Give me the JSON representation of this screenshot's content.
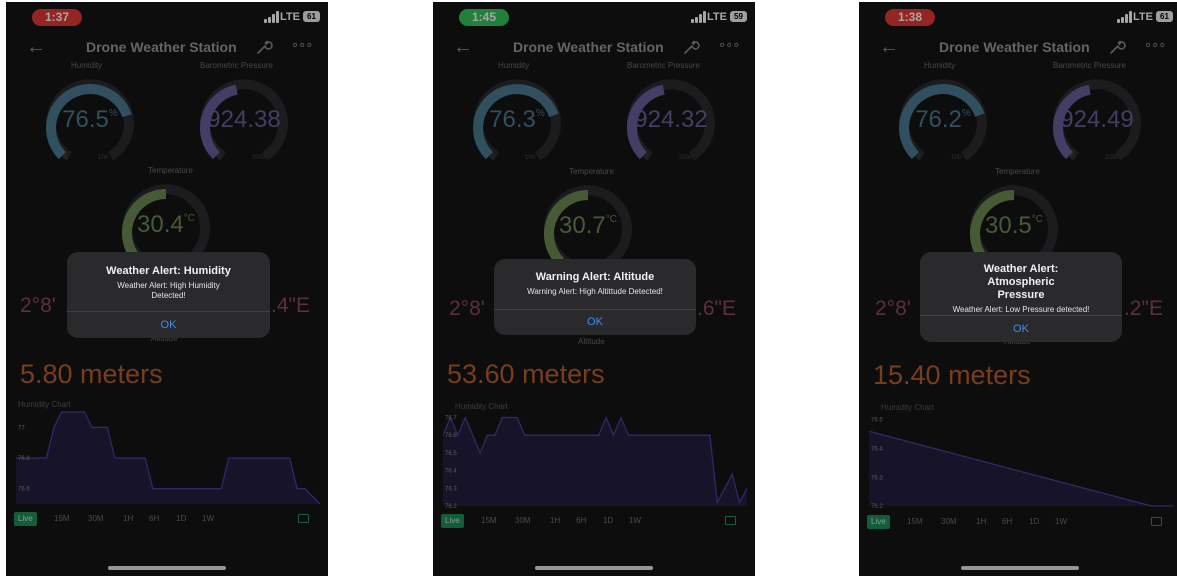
{
  "screens": [
    {
      "status": {
        "time": "1:37",
        "pill_color": "#e53935",
        "lte": "LTE",
        "battery": "61"
      },
      "nav": {
        "title": "Drone Weather Station"
      },
      "humidity": {
        "label": "Humidity",
        "value": "76.5",
        "unit": "%",
        "min": "0",
        "max": "100",
        "fraction": 0.765
      },
      "pressure": {
        "label": "Barometric Pressure",
        "value": "924.38",
        "min": "0",
        "max": "2000",
        "fraction": 0.46
      },
      "temperature": {
        "label": "Temperature",
        "value": "30.4",
        "unit": "°C",
        "fraction": 0.5
      },
      "coords": {
        "left": "2°8'",
        "right": ".4\"E"
      },
      "altitude": {
        "label": "Altitude",
        "value": "5.80 meters"
      },
      "chart_title": "Humidity Chart",
      "ranges": [
        "Live",
        "15M",
        "30M",
        "1H",
        "6H",
        "1D",
        "1W"
      ],
      "alert": {
        "title": "Weather Alert: Humidity",
        "message": "Weather Alert: High Humidity Detected!",
        "ok": "OK"
      }
    },
    {
      "status": {
        "time": "1:45",
        "pill_color": "#34c759",
        "lte": "LTE",
        "battery": "59"
      },
      "nav": {
        "title": "Drone Weather Station"
      },
      "humidity": {
        "label": "Humidity",
        "value": "76.3",
        "unit": "%",
        "min": "0",
        "max": "100",
        "fraction": 0.763
      },
      "pressure": {
        "label": "Barometric Pressure",
        "value": "924.32",
        "min": "0",
        "max": "2000",
        "fraction": 0.46
      },
      "temperature": {
        "label": "Temperature",
        "value": "30.7",
        "unit": "°C",
        "fraction": 0.5
      },
      "coords": {
        "left": "2°8'",
        "right": ".6\"E"
      },
      "altitude": {
        "label": "Altitude",
        "value": "53.60 meters"
      },
      "chart_title": "Humidity Chart",
      "ranges": [
        "Live",
        "15M",
        "30M",
        "1H",
        "6H",
        "1D",
        "1W"
      ],
      "alert": {
        "title": "Warning Alert: Altitude",
        "message": "Warning Alert: High Altittude Detected!",
        "ok": "OK"
      }
    },
    {
      "status": {
        "time": "1:38",
        "pill_color": "#e53935",
        "lte": "LTE",
        "battery": "61"
      },
      "nav": {
        "title": "Drone Weather Station"
      },
      "humidity": {
        "label": "Humidity",
        "value": "76.2",
        "unit": "%",
        "min": "0",
        "max": "100",
        "fraction": 0.762
      },
      "pressure": {
        "label": "Barometric Pressure",
        "value": "924.49",
        "min": "0",
        "max": "2000",
        "fraction": 0.46
      },
      "temperature": {
        "label": "Temperature",
        "value": "30.5",
        "unit": "°C",
        "fraction": 0.5
      },
      "coords": {
        "left": "2°8'",
        "right": ".2\"E"
      },
      "altitude": {
        "label": "Altitude",
        "value": "15.40 meters"
      },
      "chart_title": "Humidity Chart",
      "ranges": [
        "Live",
        "15M",
        "30M",
        "1H",
        "6H",
        "1D",
        "1W"
      ],
      "alert": {
        "title": "Weather Alert: Atmospheric Pressure",
        "message": "Weather Alert: Low Pressure detected!",
        "ok": "OK"
      }
    }
  ],
  "chart_data": [
    {
      "type": "area",
      "ticks": [
        "77",
        "76.8",
        "76.6"
      ],
      "ylim": [
        76.5,
        77.1
      ],
      "y": [
        76.8,
        76.8,
        76.8,
        76.8,
        76.8,
        77,
        77.1,
        77.1,
        77.1,
        77.1,
        77,
        77,
        77,
        76.8,
        76.8,
        76.8,
        76.8,
        76.8,
        76.6,
        76.6,
        76.6,
        76.6,
        76.6,
        76.6,
        76.6,
        76.6,
        76.6,
        76.6,
        76.8,
        76.8,
        76.8,
        76.8,
        76.8,
        76.8,
        76.8,
        76.8,
        76.8,
        76.6,
        76.6,
        76.55,
        76.5
      ]
    },
    {
      "type": "area",
      "ticks": [
        "76.7",
        "76.6",
        "76.5",
        "76.4",
        "76.3",
        "76.2"
      ],
      "ylim": [
        76.2,
        76.72
      ],
      "y": [
        76.6,
        76.7,
        76.6,
        76.7,
        76.6,
        76.5,
        76.6,
        76.6,
        76.7,
        76.7,
        76.7,
        76.6,
        76.6,
        76.6,
        76.6,
        76.6,
        76.6,
        76.6,
        76.6,
        76.6,
        76.6,
        76.6,
        76.7,
        76.6,
        76.7,
        76.6,
        76.6,
        76.6,
        76.6,
        76.6,
        76.6,
        76.6,
        76.6,
        76.6,
        76.6,
        76.6,
        76.6,
        76.22,
        76.3,
        76.38,
        76.22,
        76.3
      ]
    },
    {
      "type": "area",
      "ticks": [
        "76.5",
        "76.4",
        "76.3",
        "76.2"
      ],
      "ylim": [
        76.2,
        76.52
      ],
      "y": [
        76.46,
        76.44,
        76.42,
        76.4,
        76.38,
        76.36,
        76.34,
        76.32,
        76.3,
        76.28,
        76.26,
        76.24,
        76.22,
        76.2,
        76.2
      ]
    }
  ],
  "style": {
    "humidity_color": "#4a7a93",
    "pressure_color": "#6a5e9c",
    "temperature_color": "#6d8a54",
    "track_color": "#2b2b2f",
    "chart_line": "#4b3fa0",
    "chart_fill": "#241f3f",
    "live_color": "#1f8f5a",
    "alert_ok_color": "#3d8df3"
  }
}
